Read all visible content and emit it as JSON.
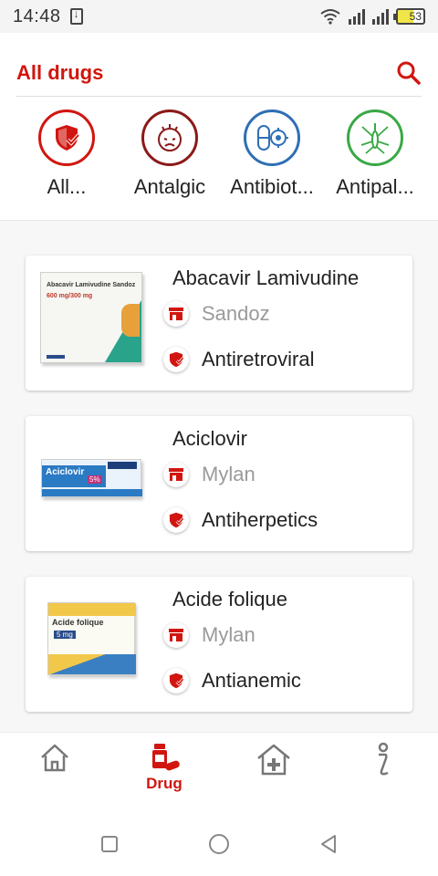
{
  "status_bar": {
    "time": "14:48",
    "battery": "53"
  },
  "header": {
    "title": "All drugs"
  },
  "categories": [
    {
      "label": "All...",
      "icon": "shield-check-icon",
      "color": "#d1160f"
    },
    {
      "label": "Antalgic",
      "icon": "headache-face-icon",
      "color": "#8b1a1a"
    },
    {
      "label": "Antibiot...",
      "icon": "capsule-bacteria-icon",
      "color": "#2f6fb5"
    },
    {
      "label": "Antipal...",
      "icon": "mosquito-icon",
      "color": "#3aa845"
    }
  ],
  "drugs": [
    {
      "name": "Abacavir Lamivudine",
      "lab": "Sandoz",
      "class": "Antiretroviral",
      "box_text": "Abacavir Lamivudine Sandoz",
      "box_dose": "600 mg/300 mg"
    },
    {
      "name": "Aciclovir",
      "lab": "Mylan",
      "class": "Antiherpetics",
      "box_text": "Aciclovir",
      "box_dose": "5%"
    },
    {
      "name": "Acide folique",
      "lab": "Mylan",
      "class": "Antianemic",
      "box_text": "Acide folique",
      "box_dose": "5 mg"
    }
  ],
  "bottom_nav": [
    {
      "label": "",
      "icon": "home-icon"
    },
    {
      "label": "Drug",
      "icon": "drug-icon"
    },
    {
      "label": "",
      "icon": "pharmacy-icon"
    },
    {
      "label": "",
      "icon": "info-icon"
    }
  ],
  "colors": {
    "accent": "#d1160f",
    "lab_text": "#9a9a9a"
  }
}
